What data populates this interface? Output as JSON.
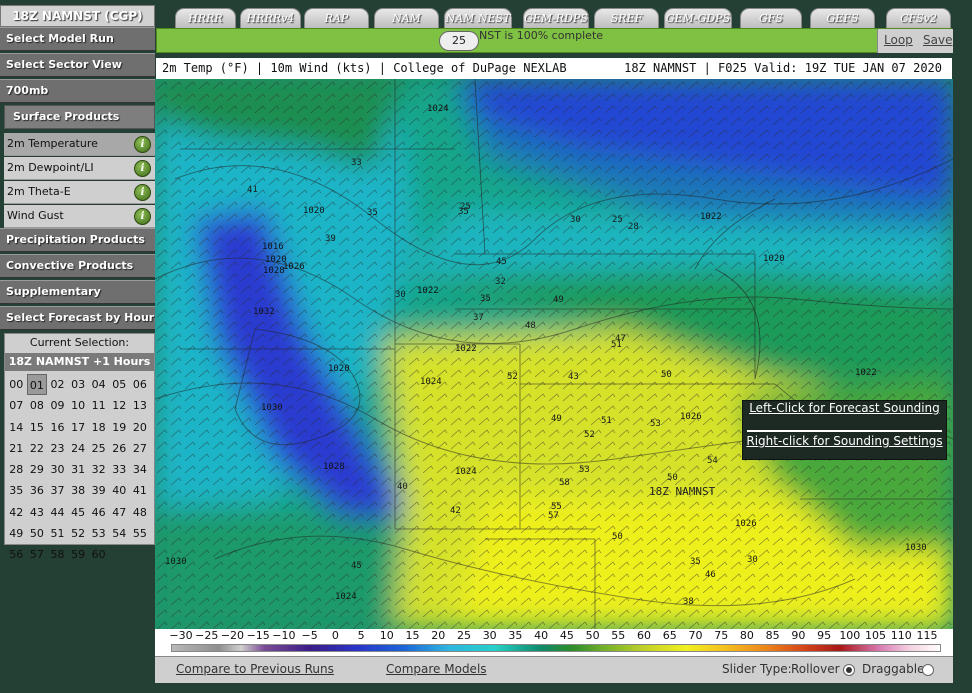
{
  "sidebar": {
    "title": "18Z NAMNST (CGP)",
    "sections": [
      "Select Model Run",
      "Select Sector View",
      "700mb"
    ],
    "surface_products_label": "Surface Products",
    "surface_items": [
      {
        "label": "2m Temperature",
        "active": true
      },
      {
        "label": "2m Dewpoint/LI",
        "active": false
      },
      {
        "label": "2m Theta-E",
        "active": false
      },
      {
        "label": "Wind Gust",
        "active": false
      }
    ],
    "info_glyph": "i",
    "more_sections": [
      "Precipitation Products",
      "Convective Products",
      "Supplementary Products",
      "Select Forecast by Hour"
    ],
    "current_selection_label": "Current Selection:",
    "current_selection_value": "18Z NAMNST +1 Hours",
    "hours": [
      "00",
      "01",
      "02",
      "03",
      "04",
      "05",
      "06",
      "07",
      "08",
      "09",
      "10",
      "11",
      "12",
      "13",
      "14",
      "15",
      "16",
      "17",
      "18",
      "19",
      "20",
      "21",
      "22",
      "23",
      "24",
      "25",
      "26",
      "27",
      "28",
      "29",
      "30",
      "31",
      "32",
      "33",
      "34",
      "35",
      "36",
      "37",
      "38",
      "39",
      "40",
      "41",
      "42",
      "43",
      "44",
      "45",
      "46",
      "47",
      "48",
      "49",
      "50",
      "51",
      "52",
      "53",
      "54",
      "55",
      "56",
      "57",
      "58",
      "59",
      "60"
    ],
    "selected_hour": "01"
  },
  "tabs": [
    "HRRR",
    "HRRRv4",
    "RAP",
    "NAM",
    "NAM NEST",
    "GEM-RDPS",
    "SREF",
    "GEM-GDPS",
    "GFS",
    "GEFS",
    "CFSv2"
  ],
  "progress": {
    "slider_value": "25",
    "text": "NST is 100% complete",
    "loop_label": "Loop",
    "save_label": "Save"
  },
  "header": {
    "left": "2m Temp (°F) | 10m Wind (kts) | College of DuPage NEXLAB",
    "right": "18Z NAMNST | F025 Valid: 19Z TUE JAN 07 2020"
  },
  "map": {
    "contour_labels": [
      "1024",
      "1020",
      "1016",
      "1020",
      "1022",
      "1028",
      "1032",
      "1030",
      "1026",
      "1022",
      "1024",
      "1020",
      "1024",
      "1030",
      "1028",
      "1026",
      "1026",
      "1030",
      "1022",
      "1022",
      "1020",
      "1024"
    ],
    "temp_labels": [
      "33",
      "35",
      "41",
      "35",
      "39",
      "30",
      "25",
      "30",
      "25",
      "28",
      "32",
      "35",
      "37",
      "45",
      "48",
      "49",
      "51",
      "53",
      "52",
      "50",
      "54",
      "55",
      "57",
      "58",
      "53",
      "50",
      "46",
      "30",
      "35",
      "38",
      "40",
      "42",
      "45",
      "47",
      "50",
      "51",
      "43",
      "49",
      "52"
    ],
    "watermark": "18Z NAMNST",
    "popup": {
      "left_click": "Left-Click for Forecast Sounding",
      "right_click": "Right-click for Sounding Settings"
    }
  },
  "colorbar": {
    "labels": [
      "−30",
      "−25",
      "−20",
      "−15",
      "−10",
      "−5",
      "0",
      "5",
      "10",
      "15",
      "20",
      "25",
      "30",
      "35",
      "40",
      "45",
      "50",
      "55",
      "60",
      "65",
      "70",
      "75",
      "80",
      "85",
      "90",
      "95",
      "100",
      "105",
      "110",
      "115"
    ]
  },
  "bottom": {
    "compare_prev": "Compare to Previous Runs",
    "compare_models": "Compare Models",
    "slider_type_label": "Slider Type:",
    "rollover": "Rollover",
    "draggable": "Draggable",
    "selected_slider_type": "Rollover"
  }
}
